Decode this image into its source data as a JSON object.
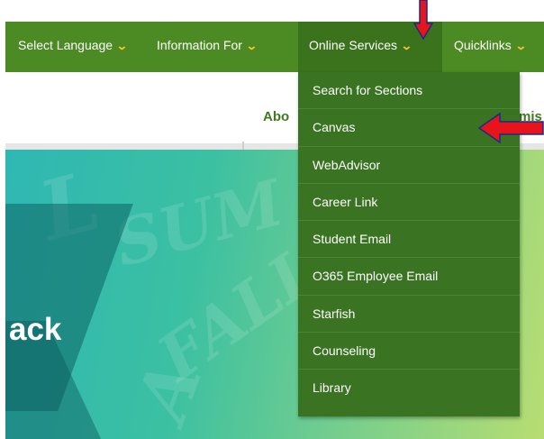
{
  "nav": {
    "items": [
      {
        "label": "Select Language"
      },
      {
        "label": "Information For"
      },
      {
        "label": "Online Services"
      },
      {
        "label": "Quicklinks"
      }
    ]
  },
  "subnav": {
    "about_partial": "Abo",
    "admissions_partial": "mis"
  },
  "hero": {
    "headline_partial": "ack"
  },
  "dropdown": {
    "items": [
      {
        "label": "Search for Sections"
      },
      {
        "label": "Canvas"
      },
      {
        "label": "WebAdvisor"
      },
      {
        "label": "Career Link"
      },
      {
        "label": "Student Email"
      },
      {
        "label": "O365 Employee Email"
      },
      {
        "label": "Starfish"
      },
      {
        "label": "Counseling"
      },
      {
        "label": "Library"
      }
    ]
  },
  "colors": {
    "nav_bg": "#4c8a24",
    "nav_active": "#3a731c",
    "dropdown_bg": "#3a7321",
    "chevron": "#f4c430",
    "annotation_arrow": "#e8141c"
  },
  "icons": {
    "chevron": "chevron-down-icon",
    "annotation": "red-arrow-icon"
  }
}
